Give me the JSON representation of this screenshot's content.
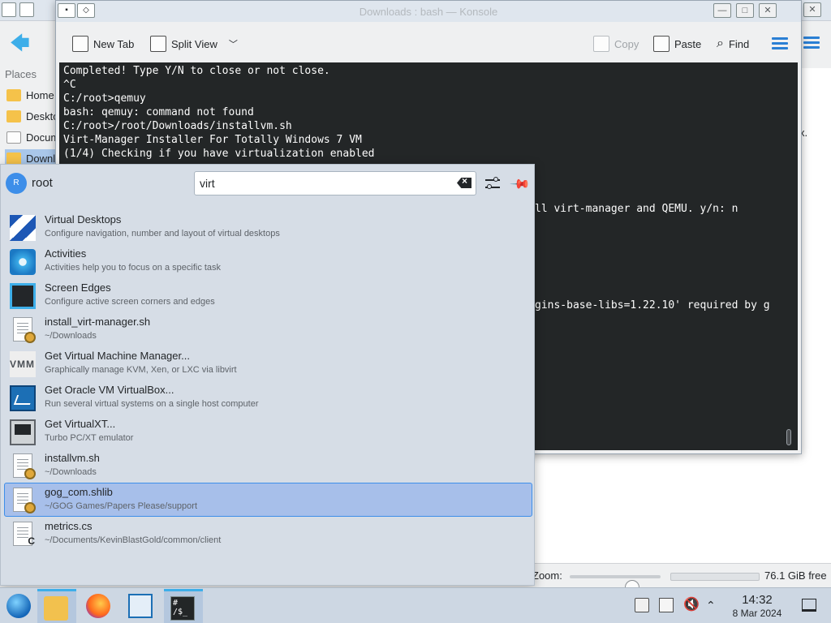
{
  "file_manager": {
    "places_title": "Places",
    "places": [
      {
        "label": "Home",
        "selected": false
      },
      {
        "label": "Desktop",
        "selected": false
      },
      {
        "label": "Documents",
        "selected": false
      },
      {
        "label": "Downloads",
        "selected": true
      }
    ],
    "visible_fragment": "x.",
    "zoom_label": "Zoom:",
    "free_space": "76.1 GiB free"
  },
  "konsole": {
    "title": "Downloads : bash — Konsole",
    "toolbar": {
      "new_tab": "New Tab",
      "split_view": "Split View",
      "copy": "Copy",
      "paste": "Paste",
      "find": "Find"
    },
    "terminal_lines": [
      "Completed! Type Y/N to close or not close.",
      "^C",
      "C:/root>qemuy",
      "bash: qemuy: command not found",
      "C:/root>/root/Downloads/installvm.sh",
      "Virt-Manager Installer For Totally Windows 7 VM",
      "(1/4) Checking if you have virtualization enabled"
    ],
    "terminal_partial_1": "ll virt-manager and QEMU. y/n: n",
    "terminal_partial_2": "gins-base-libs=1.22.10' required by g"
  },
  "krunner": {
    "user_initial": "R",
    "user_name": "root",
    "query": "virt",
    "results": [
      {
        "name": "Virtual Desktops",
        "description": "Configure navigation, number and layout of virtual desktops",
        "icon": "virtual-desktops-icon",
        "selected": false
      },
      {
        "name": "Activities",
        "description": "Activities help you to focus on a specific task",
        "icon": "activities-icon",
        "selected": false
      },
      {
        "name": "Screen Edges",
        "description": "Configure active screen corners and edges",
        "icon": "screen-edges-icon",
        "selected": false
      },
      {
        "name": "install_virt-manager.sh",
        "description": "~/Downloads",
        "icon": "shell-script-icon",
        "selected": false
      },
      {
        "name": "Get Virtual Machine Manager...",
        "description": "Graphically manage KVM, Xen, or LXC via libvirt",
        "icon": "virt-manager-icon",
        "selected": false
      },
      {
        "name": "Get Oracle VM VirtualBox...",
        "description": "Run several virtual systems on a single host computer",
        "icon": "virtualbox-icon",
        "selected": false
      },
      {
        "name": "Get VirtualXT...",
        "description": "Turbo PC/XT emulator",
        "icon": "virtualxt-icon",
        "selected": false
      },
      {
        "name": "installvm.sh",
        "description": "~/Downloads",
        "icon": "shell-script-icon",
        "selected": false
      },
      {
        "name": "gog_com.shlib",
        "description": "~/GOG Games/Papers Please/support",
        "icon": "shell-library-icon",
        "selected": true
      },
      {
        "name": "metrics.cs",
        "description": "~/Documents/KevinBlastGold/common/client",
        "icon": "csharp-source-icon",
        "selected": false
      }
    ]
  },
  "taskbar": {
    "konsole_label": "# /$_",
    "time": "14:32",
    "date": "8 Mar 2024"
  }
}
